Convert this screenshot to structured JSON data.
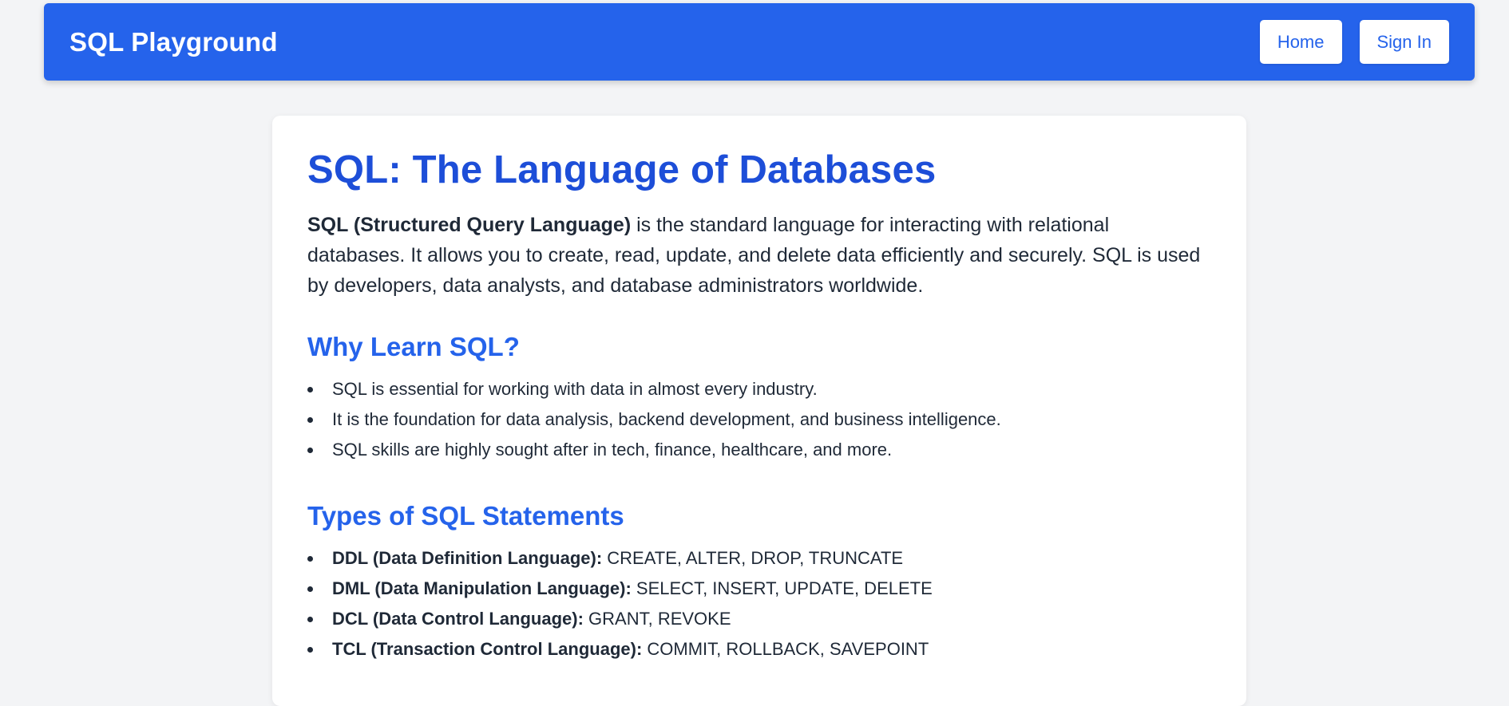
{
  "header": {
    "brand": "SQL Playground",
    "nav": {
      "home": "Home",
      "sign_in": "Sign In"
    }
  },
  "main": {
    "title": "SQL: The Language of Databases",
    "intro": {
      "strong": "SQL (Structured Query Language)",
      "rest": " is the standard language for interacting with relational databases. It allows you to create, read, update, and delete data efficiently and securely. SQL is used by developers, data analysts, and database administrators worldwide."
    },
    "why_section": {
      "heading": "Why Learn SQL?",
      "items": [
        "SQL is essential for working with data in almost every industry.",
        "It is the foundation for data analysis, backend development, and business intelligence.",
        "SQL skills are highly sought after in tech, finance, healthcare, and more."
      ]
    },
    "types_section": {
      "heading": "Types of SQL Statements",
      "items": [
        {
          "label": "DDL (Data Definition Language):",
          "value": " CREATE, ALTER, DROP, TRUNCATE"
        },
        {
          "label": "DML (Data Manipulation Language):",
          "value": " SELECT, INSERT, UPDATE, DELETE"
        },
        {
          "label": "DCL (Data Control Language):",
          "value": " GRANT, REVOKE"
        },
        {
          "label": "TCL (Transaction Control Language):",
          "value": " COMMIT, ROLLBACK, SAVEPOINT"
        }
      ]
    }
  },
  "colors": {
    "header_bg": "#2563eb",
    "page_bg": "#f3f4f6",
    "title": "#1d4ed8",
    "section_heading": "#2563eb",
    "body_text": "#1f2937"
  }
}
